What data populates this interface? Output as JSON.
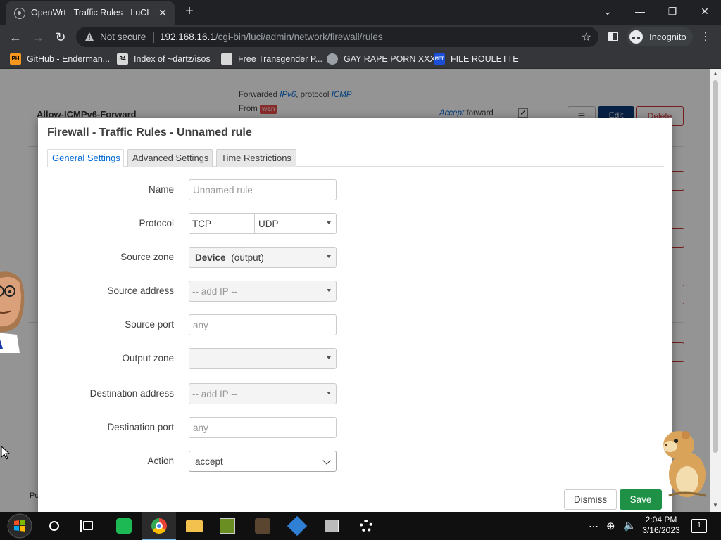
{
  "browser": {
    "tab_title": "OpenWrt - Traffic Rules - LuCI",
    "not_secure": "Not secure",
    "url_host": "192.168.16.1",
    "url_path": "/cgi-bin/luci/admin/network/firewall/rules",
    "profile_label": "Incognito",
    "bookmarks": [
      {
        "label": "GitHub - Enderman...",
        "icon": "pornhub-icon",
        "icon_text": "PH",
        "color": "#f7971d"
      },
      {
        "label": "Index of ~dartz/isos",
        "icon": "folder-34-icon",
        "icon_text": "34",
        "color": "#d8d8d8"
      },
      {
        "label": "Free Transgender P...",
        "icon": "transgender-icon",
        "icon_text": "",
        "color": "#d8d8d8"
      },
      {
        "label": "GAY RAPE PORN XXX",
        "icon": "globe-icon",
        "icon_text": "",
        "color": "#9aa0a6"
      },
      {
        "label": "FILE ROULETTE",
        "icon": "mft-icon",
        "icon_text": "MFT",
        "color": "#1a4fd6"
      }
    ]
  },
  "background": {
    "rule_title": "Allow-ICMPv6-Forward",
    "meta_line1_prefix": "Forwarded",
    "meta_line1_link1": "IPv6",
    "meta_line1_mid": ", protocol",
    "meta_line1_link2": "ICMP",
    "meta_line2_prefix": "From",
    "meta_line2_tag": "wan",
    "action_link": "Accept",
    "action_suffix": "forward",
    "btn_menu": "☰",
    "btn_edit": "Edit",
    "btn_delete": "Delete",
    "footer": "Po"
  },
  "modal": {
    "title": "Firewall - Traffic Rules - Unnamed rule",
    "tabs": [
      "General Settings",
      "Advanced Settings",
      "Time Restrictions"
    ],
    "fields": {
      "name": {
        "label": "Name",
        "placeholder": "Unnamed rule"
      },
      "protocol": {
        "label": "Protocol",
        "values": [
          "TCP",
          "UDP"
        ]
      },
      "source_zone": {
        "label": "Source zone",
        "value_bold": "Device",
        "value_suffix": "(output)"
      },
      "source_address": {
        "label": "Source address",
        "placeholder": "-- add IP --"
      },
      "source_port": {
        "label": "Source port",
        "placeholder": "any"
      },
      "output_zone": {
        "label": "Output zone",
        "value": ""
      },
      "destination_address": {
        "label": "Destination address",
        "placeholder": "-- add IP --"
      },
      "destination_port": {
        "label": "Destination port",
        "placeholder": "any"
      },
      "action": {
        "label": "Action",
        "value": "accept"
      }
    },
    "dismiss": "Dismiss",
    "save": "Save"
  },
  "taskbar": {
    "time": "2:04 PM",
    "date": "3/16/2023",
    "notification_count": "1"
  },
  "colors": {
    "accent": "#0069d6",
    "save_green": "#1e9146",
    "delete_red": "#c33"
  }
}
